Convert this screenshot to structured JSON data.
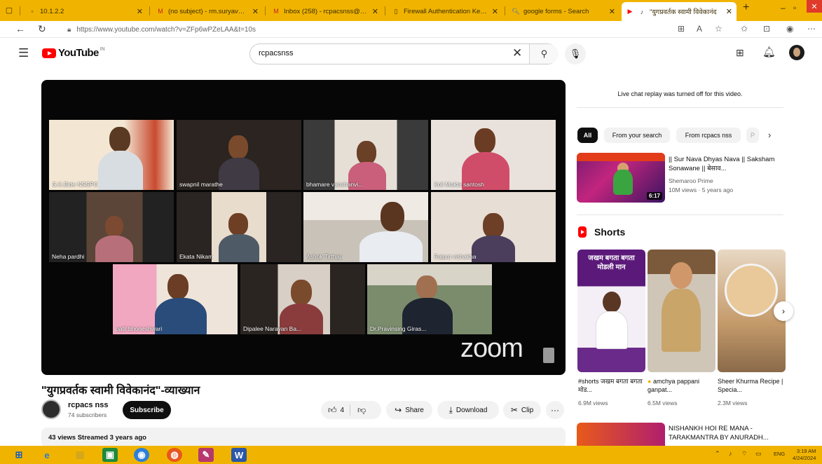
{
  "browser": {
    "tabs": [
      {
        "title": "10.1.2.2",
        "icon": "page-icon",
        "active": false
      },
      {
        "title": "(no subject) - rm.suryavanshi",
        "icon": "gmail-icon",
        "active": false
      },
      {
        "title": "Inbox (258) - rcpacsnss@gmail",
        "icon": "gmail-icon",
        "active": false
      },
      {
        "title": "Firewall Authentication Keep",
        "icon": "page-icon",
        "active": false
      },
      {
        "title": "google forms - Search",
        "icon": "search-icon",
        "active": false
      },
      {
        "title": "\"युगप्रवर्तक स्वामी विवेकानंद",
        "icon": "youtube-icon",
        "active": true
      }
    ],
    "new_tab": "+",
    "url": "https://www.youtube.com/watch?v=ZFp6wPZeLAA&t=10s"
  },
  "youtube": {
    "logo_text": "YouTube",
    "logo_region": "IN",
    "search_value": "rcpacsnss",
    "search_placeholder": "Search"
  },
  "video": {
    "participants": [
      {
        "name": "G.K.Bide NSSPO"
      },
      {
        "name": "swapnil marathe"
      },
      {
        "name": "bhamare vanshanvi..."
      },
      {
        "name": "Koli Mukta santosh"
      },
      {
        "name": "Neha pardhi"
      },
      {
        "name": "Ekata Nikam"
      },
      {
        "name": "Ashok Tirthap"
      },
      {
        "name": "Rajput vishakha"
      },
      {
        "name": "patil bhoneshwari"
      },
      {
        "name": "Dipalee Narayan Ba..."
      },
      {
        "name": "Dr.Pravinsing Giras..."
      }
    ],
    "zoom_mark": "zoom",
    "title": "\"युगप्रवर्तक स्वामी विवेकानंद\"-व्याख्यान",
    "channel_name": "rcpacs nss",
    "subscribers": "74 subscribers",
    "subscribe_label": "Subscribe",
    "like_count": "4",
    "share_label": "Share",
    "download_label": "Download",
    "clip_label": "Clip",
    "more_label": "···",
    "meta": "43 views  Streamed 3 years ago"
  },
  "sidebar": {
    "live_chat_note": "Live chat replay was turned off for this video.",
    "chips": [
      "All",
      "From your search",
      "From rcpacs nss",
      "P"
    ],
    "recommendation": {
      "title": "|| Sur Nava Dhyas Nava || Saksham Sonawane || बेसाव...",
      "channel": "Shemaroo Prime",
      "stats": "10M views · 5 years ago",
      "duration": "6:17"
    },
    "shorts_heading": "Shorts",
    "shorts": [
      {
        "title": "#shorts जखम बगता बगता मोड...",
        "views": "6.9M views",
        "overlay": "जखम बगता बगता मोडली मान"
      },
      {
        "title": "amchya pappani ganpat...",
        "views": "6.5M views"
      },
      {
        "title": "Sheer Khurma Recipe | Specia...",
        "views": "2.3M views"
      }
    ],
    "recommendation2": {
      "title": "NISHANKH HOI RE MANA - TARAKMANTRA BY ANURADH..."
    }
  },
  "taskbar": {
    "apps": [
      "windows-start",
      "edge",
      "file-explorer",
      "store",
      "chrome",
      "firefox",
      "paint",
      "word"
    ],
    "lang": "ENG",
    "time": "3:19 AM",
    "date": "4/24/2024"
  },
  "colors": {
    "accent_bar": "#f0b400",
    "yt_red": "#ff0000",
    "active_speaker": "#3bd13b"
  }
}
